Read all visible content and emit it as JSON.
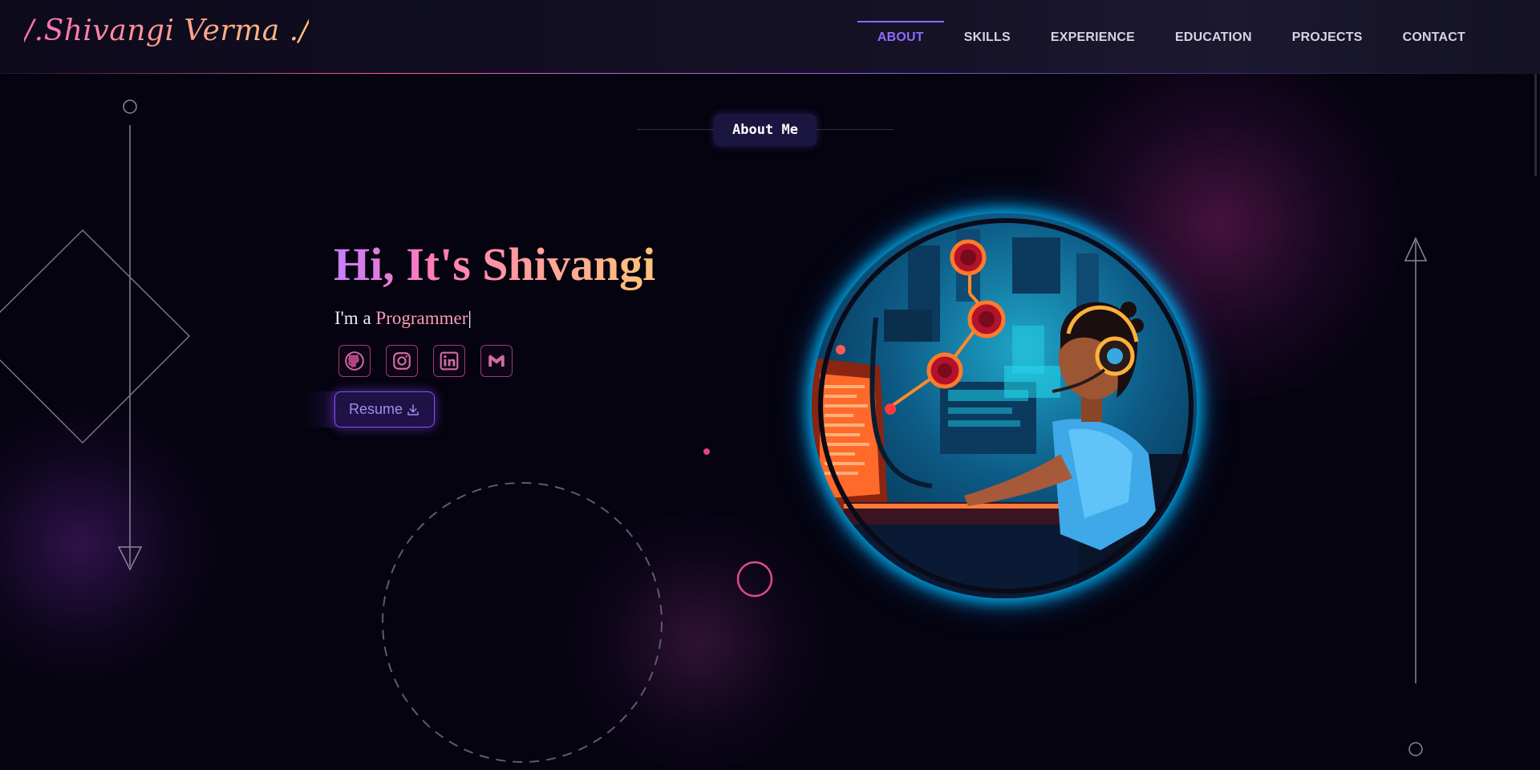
{
  "navbar": {
    "logo": "/.Shivangi Verma ./",
    "links": [
      "ABOUT",
      "SKILLS",
      "EXPERIENCE",
      "EDUCATION",
      "PROJECTS",
      "CONTACT"
    ],
    "active": "ABOUT"
  },
  "section": {
    "title": "About Me"
  },
  "hero": {
    "greeting": "Hi, It's Shivangi",
    "subtitle_prefix": "I'm a ",
    "role": "Programmer",
    "caret": "|",
    "resume_label": "Resume"
  },
  "socials": [
    {
      "name": "github",
      "icon": "github-icon"
    },
    {
      "name": "instagram",
      "icon": "instagram-icon"
    },
    {
      "name": "linkedin",
      "icon": "linkedin-icon"
    },
    {
      "name": "gmail",
      "icon": "gmail-icon"
    }
  ],
  "colors": {
    "background": "#05030f",
    "accent_purple": "#8f6bff",
    "accent_pink": "#ff5fa8",
    "accent_orange": "#ffc47a",
    "avatar_glow": "#00beff"
  }
}
